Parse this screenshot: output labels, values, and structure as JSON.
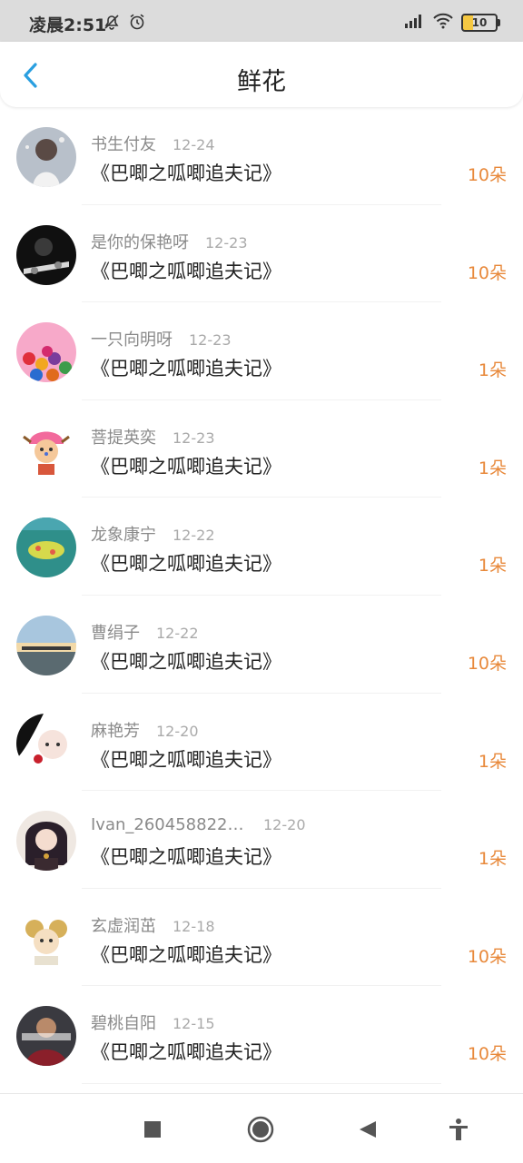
{
  "status_bar": {
    "time": "凌晨2:51",
    "battery": "10",
    "icons": [
      "mute-bell-icon",
      "alarm-icon",
      "signal-icon",
      "wifi-icon",
      "battery-icon"
    ]
  },
  "header": {
    "title": "鲜花",
    "back_icon": "chevron-left-icon"
  },
  "items": [
    {
      "name": "书生付友",
      "date": "12-24",
      "book": "《巴唧之呱唧追夫记》",
      "count": "10朵"
    },
    {
      "name": "是你的保艳呀",
      "date": "12-23",
      "book": "《巴唧之呱唧追夫记》",
      "count": "10朵"
    },
    {
      "name": "一只向明呀",
      "date": "12-23",
      "book": "《巴唧之呱唧追夫记》",
      "count": "1朵"
    },
    {
      "name": "菩提英奕",
      "date": "12-23",
      "book": "《巴唧之呱唧追夫记》",
      "count": "1朵"
    },
    {
      "name": "龙象康宁",
      "date": "12-22",
      "book": "《巴唧之呱唧追夫记》",
      "count": "1朵"
    },
    {
      "name": "曹绢子",
      "date": "12-22",
      "book": "《巴唧之呱唧追夫记》",
      "count": "10朵"
    },
    {
      "name": "麻艳芳",
      "date": "12-20",
      "book": "《巴唧之呱唧追夫记》",
      "count": "1朵"
    },
    {
      "name": "Ivan_2604588227...",
      "date": "12-20",
      "book": "《巴唧之呱唧追夫记》",
      "count": "1朵"
    },
    {
      "name": "玄虚润茁",
      "date": "12-18",
      "book": "《巴唧之呱唧追夫记》",
      "count": "10朵"
    },
    {
      "name": "碧桃自阳",
      "date": "12-15",
      "book": "《巴唧之呱唧追夫记》",
      "count": "10朵"
    }
  ],
  "bottom_nav": {
    "icons": [
      "recents-square-icon",
      "home-circle-icon",
      "back-triangle-icon",
      "accessibility-icon"
    ]
  },
  "colors": {
    "accent": "#e8893b",
    "back_arrow": "#2a9fe0"
  }
}
